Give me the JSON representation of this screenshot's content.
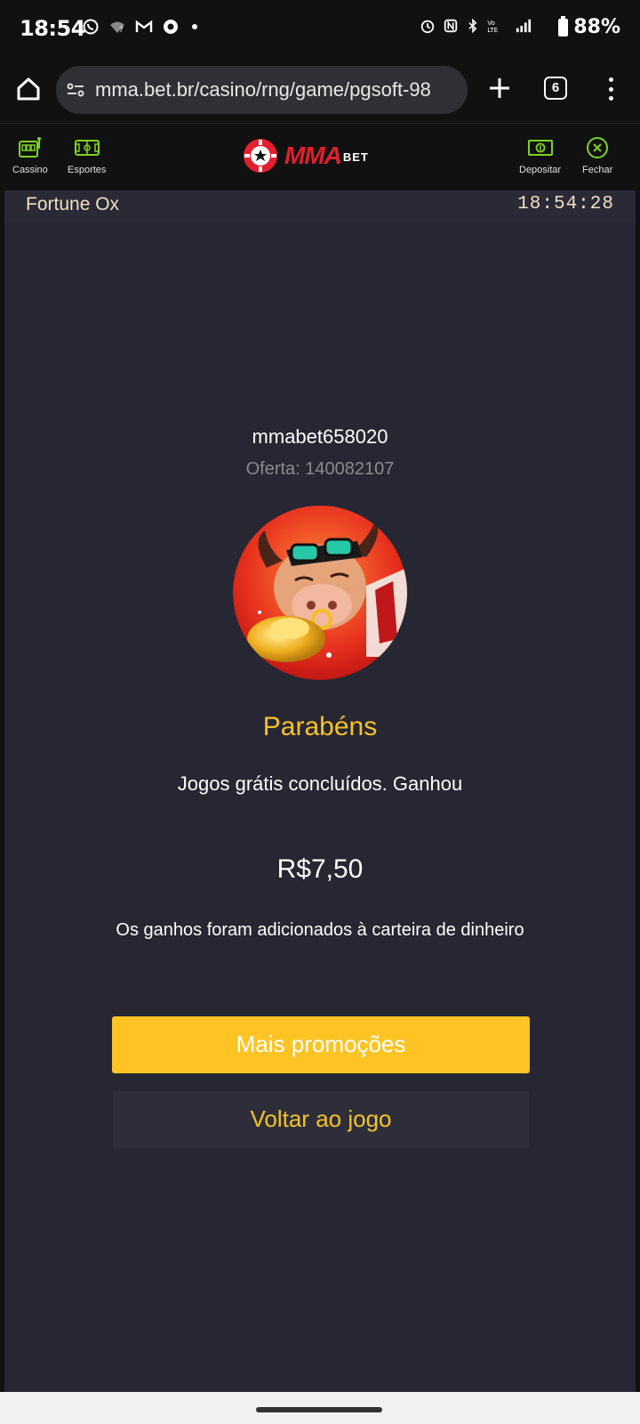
{
  "status_bar": {
    "time": "18:54",
    "battery": "88%",
    "left_icons": [
      "whatsapp-icon",
      "wifi-question-icon",
      "gmail-icon",
      "chrome-icon",
      "dot-icon"
    ],
    "right_icons": [
      "alarm-icon",
      "nfc-icon",
      "bluetooth-icon",
      "volte-icon",
      "signal-icon",
      "battery-icon"
    ]
  },
  "browser": {
    "url": "mma.bet.br/casino/rng/game/pgsoft-98",
    "tab_count": "6"
  },
  "site_header": {
    "left_items": [
      {
        "label": "Cassino",
        "icon": "slot-machine-icon"
      },
      {
        "label": "Esportes",
        "icon": "soccer-field-icon"
      }
    ],
    "logo_main": "MMA",
    "logo_sub": "BET",
    "right_items": [
      {
        "label": "Depositar",
        "icon": "cash-icon"
      },
      {
        "label": "Fechar",
        "icon": "close-circle-icon"
      }
    ],
    "accent_color": "#7ed321"
  },
  "game": {
    "title": "Fortune Ox",
    "clock": "18:54:28"
  },
  "result": {
    "username": "mmabet658020",
    "offer_label": "Oferta:",
    "offer_value": "140082107",
    "heading": "Parabéns",
    "message": "Jogos grátis concluídos. Ganhou",
    "amount": "R$7,50",
    "wallet_message": "Os ganhos foram adicionados à carteira de dinheiro"
  },
  "actions": {
    "promos_label": "Mais promoções",
    "back_label": "Voltar ao jogo"
  },
  "colors": {
    "gold": "#f5c227",
    "button_yellow": "#fdc424",
    "panel_bg": "#272733",
    "brand_red": "#e31e2d"
  }
}
